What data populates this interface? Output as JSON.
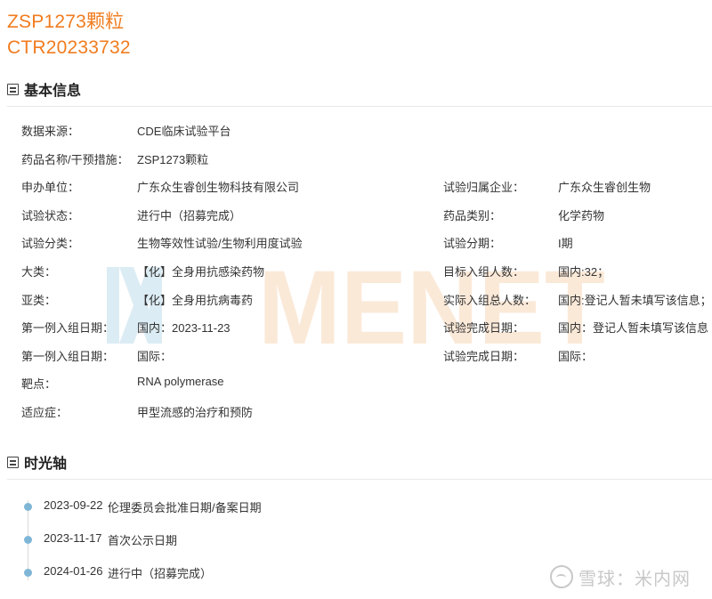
{
  "header": {
    "drug_title": "ZSP1273颗粒",
    "trial_id": "CTR20233732"
  },
  "basic_info": {
    "section_title": "基本信息",
    "rows": [
      {
        "label": "数据来源：",
        "value": "CDE临床试验平台",
        "label2": "",
        "value2": ""
      },
      {
        "label": "药品名称/干预措施：",
        "value": "ZSP1273颗粒",
        "label2": "",
        "value2": ""
      },
      {
        "label": "申办单位：",
        "value": "广东众生睿创生物科技有限公司",
        "label2": "试验归属企业：",
        "value2": "广东众生睿创生物"
      },
      {
        "label": "试验状态：",
        "value": "进行中（招募完成）",
        "label2": "药品类别：",
        "value2": "化学药物"
      },
      {
        "label": "试验分类：",
        "value": "生物等效性试验/生物利用度试验",
        "label2": "试验分期：",
        "value2": "I期"
      },
      {
        "label": "大类：",
        "value": "【化】全身用抗感染药物",
        "label2": "目标入组人数：",
        "value2": "国内:32；"
      },
      {
        "label": "亚类：",
        "value": "【化】全身用抗病毒药",
        "label2": "实际入组总人数：",
        "value2": "国内:登记人暂未填写该信息；"
      },
      {
        "label": "第一例入组日期：",
        "value": "国内：2023-11-23",
        "label2": "试验完成日期：",
        "value2": "国内：登记人暂未填写该信息"
      },
      {
        "label": "第一例入组日期：",
        "value": "国际：",
        "label2": "试验完成日期：",
        "value2": "国际："
      },
      {
        "label": "靶点：",
        "value": "RNA polymerase",
        "label2": "",
        "value2": ""
      },
      {
        "label": "适应症：",
        "value": "甲型流感的治疗和预防",
        "label2": "",
        "value2": ""
      }
    ]
  },
  "watermark": {
    "text": "MENET",
    "colors": {
      "logo": "#dcecf4",
      "text": "#fbe9d8"
    }
  },
  "timeline": {
    "section_title": "时光轴",
    "events": [
      {
        "date": "2023-09-22",
        "text": "伦理委员会批准日期/备案日期"
      },
      {
        "date": "2023-11-17",
        "text": "首次公示日期"
      },
      {
        "date": "2024-01-26",
        "text": "进行中（招募完成）"
      }
    ]
  },
  "footer_brand": {
    "text": "雪球：米内网",
    "icon": "snowball-logo-icon"
  },
  "colors": {
    "title": "#f07c1f",
    "text": "#333333",
    "timeline_dot": "#7fb6d6",
    "rule": "#e8e8e8"
  }
}
